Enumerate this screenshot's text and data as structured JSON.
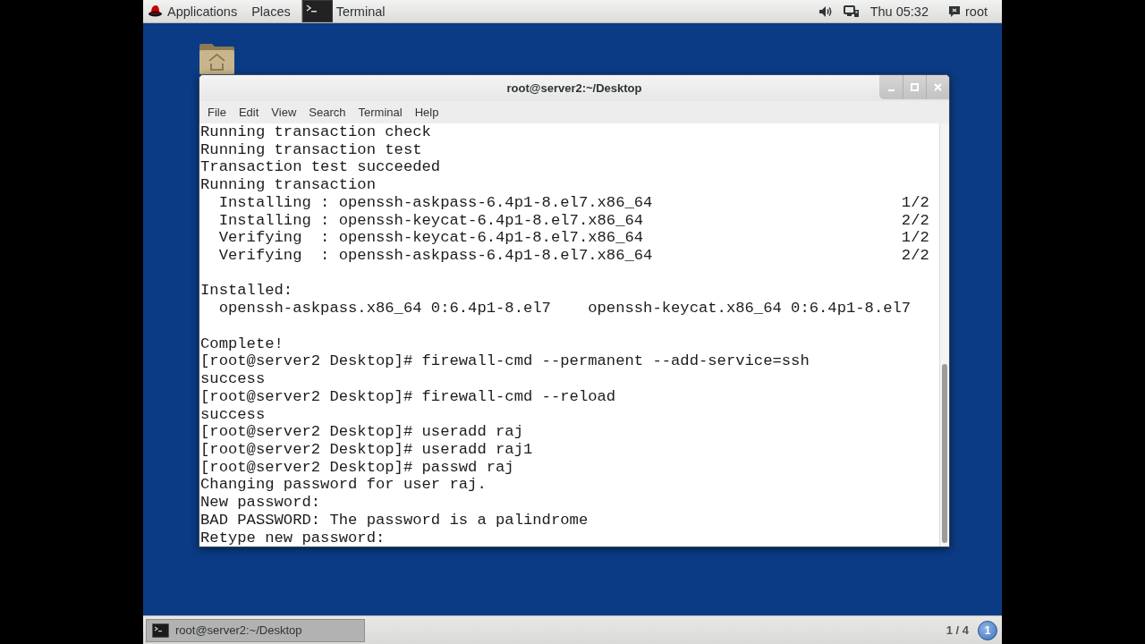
{
  "top_panel": {
    "menus": [
      "Applications",
      "Places"
    ],
    "active_app": "Terminal",
    "clock": "Thu 05:32",
    "user": "root"
  },
  "window": {
    "title": "root@server2:~/Desktop",
    "menu": [
      "File",
      "Edit",
      "View",
      "Search",
      "Terminal",
      "Help"
    ],
    "lines": [
      {
        "kind": "text",
        "text": "Running transaction check"
      },
      {
        "kind": "text",
        "text": "Running transaction test"
      },
      {
        "kind": "text",
        "text": "Transaction test succeeded"
      },
      {
        "kind": "text",
        "text": "Running transaction"
      },
      {
        "kind": "progress",
        "text": "Installing : openssh-askpass-6.4p1-8.el7.x86_64",
        "count": "1/2"
      },
      {
        "kind": "progress",
        "text": "Installing : openssh-keycat-6.4p1-8.el7.x86_64",
        "count": "2/2"
      },
      {
        "kind": "progress",
        "text": "Verifying  : openssh-keycat-6.4p1-8.el7.x86_64",
        "count": "1/2"
      },
      {
        "kind": "progress",
        "text": "Verifying  : openssh-askpass-6.4p1-8.el7.x86_64",
        "count": "2/2"
      },
      {
        "kind": "blank"
      },
      {
        "kind": "text",
        "text": "Installed:"
      },
      {
        "kind": "packages",
        "items": [
          "openssh-askpass.x86_64 0:6.4p1-8.el7",
          "openssh-keycat.x86_64 0:6.4p1-8.el7"
        ]
      },
      {
        "kind": "blank"
      },
      {
        "kind": "text",
        "text": "Complete!"
      },
      {
        "kind": "text",
        "text": "[root@server2 Desktop]# firewall-cmd --permanent --add-service=ssh"
      },
      {
        "kind": "text",
        "text": "success"
      },
      {
        "kind": "text",
        "text": "[root@server2 Desktop]# firewall-cmd --reload"
      },
      {
        "kind": "text",
        "text": "success"
      },
      {
        "kind": "text",
        "text": "[root@server2 Desktop]# useradd raj"
      },
      {
        "kind": "text",
        "text": "[root@server2 Desktop]# useradd raj1"
      },
      {
        "kind": "text",
        "text": "[root@server2 Desktop]# passwd raj"
      },
      {
        "kind": "text",
        "text": "Changing password for user raj."
      },
      {
        "kind": "text",
        "text": "New password:"
      },
      {
        "kind": "text",
        "text": "BAD PASSWORD: The password is a palindrome"
      },
      {
        "kind": "text",
        "text": "Retype new password:"
      }
    ]
  },
  "bottom_panel": {
    "tasks": [
      {
        "title": "root@server2:~/Desktop",
        "selected": true
      }
    ],
    "workspace": "1 / 4",
    "notifications": "1"
  }
}
